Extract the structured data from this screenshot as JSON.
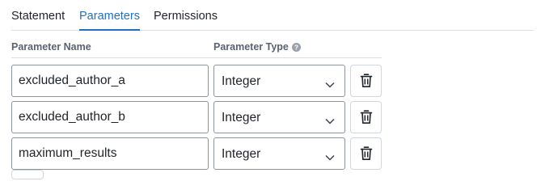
{
  "tabs": [
    {
      "label": "Statement",
      "active": false
    },
    {
      "label": "Parameters",
      "active": true
    },
    {
      "label": "Permissions",
      "active": false
    }
  ],
  "columns": {
    "name_header": "Parameter Name",
    "type_header": "Parameter Type",
    "help_icon": "question-circle-icon"
  },
  "parameters": [
    {
      "name": "excluded_author_a",
      "type": "Integer"
    },
    {
      "name": "excluded_author_b",
      "type": "Integer"
    },
    {
      "name": "maximum_results",
      "type": "Integer"
    }
  ],
  "icons": {
    "select_arrow": "chevron-down-icon",
    "delete": "trash-icon"
  },
  "colors": {
    "accent": "#1f6fc6",
    "border": "#8c959f",
    "muted_text": "#5a6270"
  }
}
